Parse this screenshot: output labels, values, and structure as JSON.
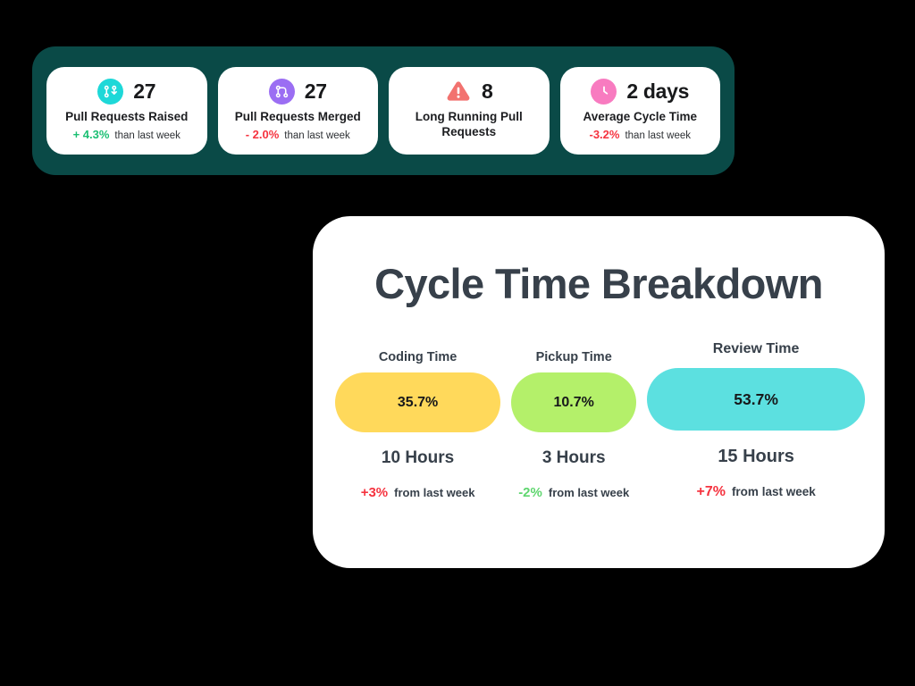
{
  "theme": {
    "page_background": "#000000",
    "panel_teal": "#0a4a47",
    "card_white": "#ffffff",
    "title_slate": "#37404a",
    "positive_green": "#1bbf73",
    "negative_red": "#f5333f",
    "bar_yellow": "#ffd95b",
    "bar_green": "#b4f06a",
    "bar_cyan": "#5ce0e0",
    "icon_cyan": "#1ed8d8",
    "icon_purple": "#9b6ef3",
    "icon_salmon": "#f2726f",
    "icon_pink": "#f87bc0"
  },
  "kpi_panel": {
    "cards": [
      {
        "icon": "pull-request-icon",
        "icon_color": "#1ed8d8",
        "value": "27",
        "title": "Pull Requests Raised",
        "delta_pct": "+ 4.3%",
        "delta_direction": "up",
        "delta_note": "than last week"
      },
      {
        "icon": "git-merge-icon",
        "icon_color": "#9b6ef3",
        "value": "27",
        "title": "Pull Requests Merged",
        "delta_pct": "- 2.0%",
        "delta_direction": "down",
        "delta_note": "than last week"
      },
      {
        "icon": "warning-triangle-icon",
        "icon_color": "#f2726f",
        "value": "8",
        "title": "Long Running Pull Requests",
        "delta_pct": "",
        "delta_direction": "none",
        "delta_note": ""
      },
      {
        "icon": "clock-icon",
        "icon_color": "#f87bc0",
        "value": "2 days",
        "title": "Average Cycle Time",
        "delta_pct": "-3.2%",
        "delta_direction": "down",
        "delta_note": "than last week"
      }
    ]
  },
  "breakdown": {
    "title": "Cycle Time Breakdown",
    "columns": [
      {
        "label": "Coding Time",
        "percent_label": "35.7%",
        "hours_label": "10 Hours",
        "delta_pct": "+3%",
        "delta_direction": "up-red",
        "delta_note": "from last week",
        "bar_color": "#ffd95b"
      },
      {
        "label": "Pickup Time",
        "percent_label": "10.7%",
        "hours_label": "3 Hours",
        "delta_pct": "-2%",
        "delta_direction": "down-green",
        "delta_note": "from last week",
        "bar_color": "#b4f06a"
      },
      {
        "label": "Review Time",
        "percent_label": "53.7%",
        "hours_label": "15 Hours",
        "delta_pct": "+7%",
        "delta_direction": "up-red",
        "delta_note": "from last week",
        "bar_color": "#5ce0e0"
      }
    ]
  },
  "chart_data": {
    "type": "bar",
    "title": "Cycle Time Breakdown",
    "orientation": "horizontal-proportional",
    "categories": [
      "Coding Time",
      "Pickup Time",
      "Review Time"
    ],
    "values": [
      35.7,
      10.7,
      53.7
    ],
    "value_unit": "percent",
    "secondary_values": [
      10,
      3,
      15
    ],
    "secondary_unit": "hours",
    "deltas": [
      3,
      -2,
      7
    ],
    "delta_unit": "percent from last week",
    "colors": [
      "#ffd95b",
      "#b4f06a",
      "#5ce0e0"
    ],
    "xlabel": "",
    "ylabel": "",
    "grid": false,
    "legend": "none"
  }
}
